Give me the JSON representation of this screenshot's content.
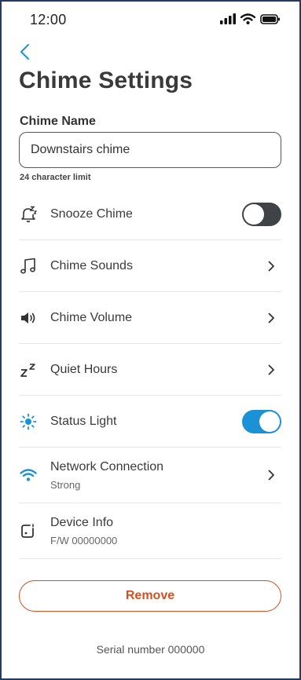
{
  "status_bar": {
    "time": "12:00"
  },
  "header": {
    "title": "Chime Settings"
  },
  "chime_name": {
    "label": "Chime Name",
    "value": "Downstairs chime",
    "helper": "24 character limit"
  },
  "settings": {
    "snooze": {
      "label": "Snooze Chime",
      "toggle_on": false
    },
    "sounds": {
      "label": "Chime Sounds"
    },
    "volume": {
      "label": "Chime Volume"
    },
    "quiet_hours": {
      "label": "Quiet Hours"
    },
    "status_light": {
      "label": "Status Light",
      "toggle_on": true
    },
    "network": {
      "label": "Network Connection",
      "status": "Strong"
    },
    "device_info": {
      "label": "Device Info",
      "firmware": "F/W 00000000"
    }
  },
  "remove_button": {
    "label": "Remove"
  },
  "footer": {
    "serial": "Serial number 000000"
  },
  "colors": {
    "accent": "#1b92d6",
    "toggle_off": "#3f4346",
    "danger": "#d4501f",
    "frame": "#243a5e"
  }
}
